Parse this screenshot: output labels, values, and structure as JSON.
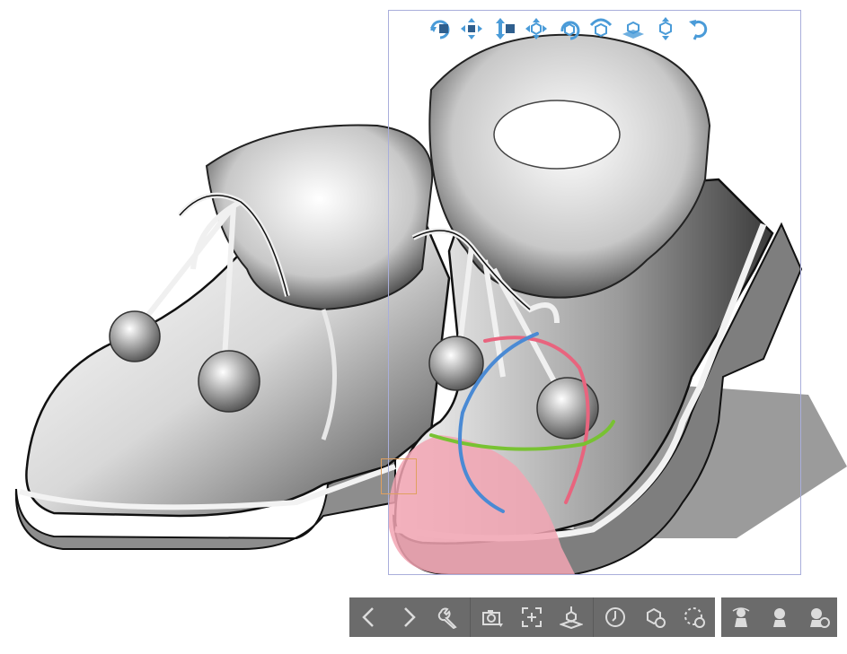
{
  "canvas": {
    "accent_color": "#4a9bd8",
    "selection_color": "#a9aedb",
    "highlight_color": "#f2a5b3",
    "gizmo_colors": {
      "x": "#e8647e",
      "y": "#78c232",
      "z": "#4a8ad4"
    }
  },
  "gizmo_toolbar": {
    "icons": [
      "camera-rotate-icon",
      "camera-pan-icon",
      "camera-dolly-icon",
      "object-move-icon",
      "object-rotate-icon",
      "object-rotate-axis-icon",
      "object-move-plane-icon",
      "object-scale-icon",
      "reset-icon"
    ]
  },
  "bottom_toolbar": {
    "groups": [
      [
        "previous-icon",
        "next-icon",
        "settings-wrench-icon"
      ],
      [
        "camera-angle-icon",
        "fit-to-view-icon",
        "ground-snap-icon"
      ],
      [
        "pose-icon",
        "object-list-icon",
        "animation-icon"
      ]
    ],
    "side_icons": [
      "hand-pose-icon",
      "head-model-icon",
      "body-model-icon"
    ],
    "background": "#6b6b6b"
  }
}
